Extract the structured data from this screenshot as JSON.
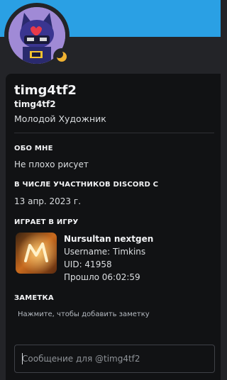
{
  "profile": {
    "display_name": "timg4tf2",
    "username": "timg4tf2",
    "custom_status": "Молодой Художник",
    "status": "idle",
    "status_icon": "moon-icon",
    "banner_color": "#2aa0e4"
  },
  "about": {
    "title": "ОБО МНЕ",
    "text": "Не плохо рисует"
  },
  "member_since": {
    "title": "В ЧИСЛЕ УЧАСТНИКОВ DISCORD С",
    "date": "13 апр. 2023 г."
  },
  "activity": {
    "title": "ИГРАЕТ В ИГРУ",
    "name": "Nursultan nextgen",
    "details": "Username: Timkins",
    "state": "UID: 41958",
    "elapsed": "Прошло 06:02:59"
  },
  "note": {
    "title": "ЗАМЕТКА",
    "placeholder": "Нажмите, чтобы добавить заметку"
  },
  "message": {
    "placeholder": "Сообщение для @timg4tf2"
  }
}
